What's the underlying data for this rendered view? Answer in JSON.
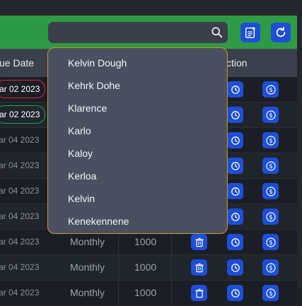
{
  "search": {
    "placeholder": "",
    "value": ""
  },
  "header": {
    "due_date": "ue Date",
    "action": "ction"
  },
  "rows": [
    {
      "date": "ar 02 2023",
      "status": "overdue",
      "frequency": "",
      "amount": ""
    },
    {
      "date": "ar 02 2023",
      "status": "paid",
      "frequency": "",
      "amount": ""
    },
    {
      "date": "ar 04 2023",
      "status": "",
      "frequency": "",
      "amount": ""
    },
    {
      "date": "ar 04 2023",
      "status": "",
      "frequency": "",
      "amount": ""
    },
    {
      "date": "ar 04 2023",
      "status": "",
      "frequency": "",
      "amount": ""
    },
    {
      "date": "ar 04 2023",
      "status": "",
      "frequency": "",
      "amount": ""
    },
    {
      "date": "ar 04 2023",
      "status": "",
      "frequency": "Monthly",
      "amount": "1000"
    },
    {
      "date": "ar 04 2023",
      "status": "",
      "frequency": "Monthly",
      "amount": "1000"
    },
    {
      "date": "ar 04 2023",
      "status": "",
      "frequency": "Monthly",
      "amount": "1000"
    }
  ],
  "dropdown": {
    "items": [
      "Kelvin Dough",
      "Kehrk Dohe",
      "Klarence",
      "Karlo",
      "Kaloy",
      "Kerloa",
      "Kelvin",
      "Kenekennene"
    ]
  },
  "colors": {
    "accent": "#1d4ed8",
    "topbar": "#2e9a45",
    "overdue": "#e11d48",
    "paid": "#16a34a",
    "dropdown_border": "#c9962b"
  }
}
